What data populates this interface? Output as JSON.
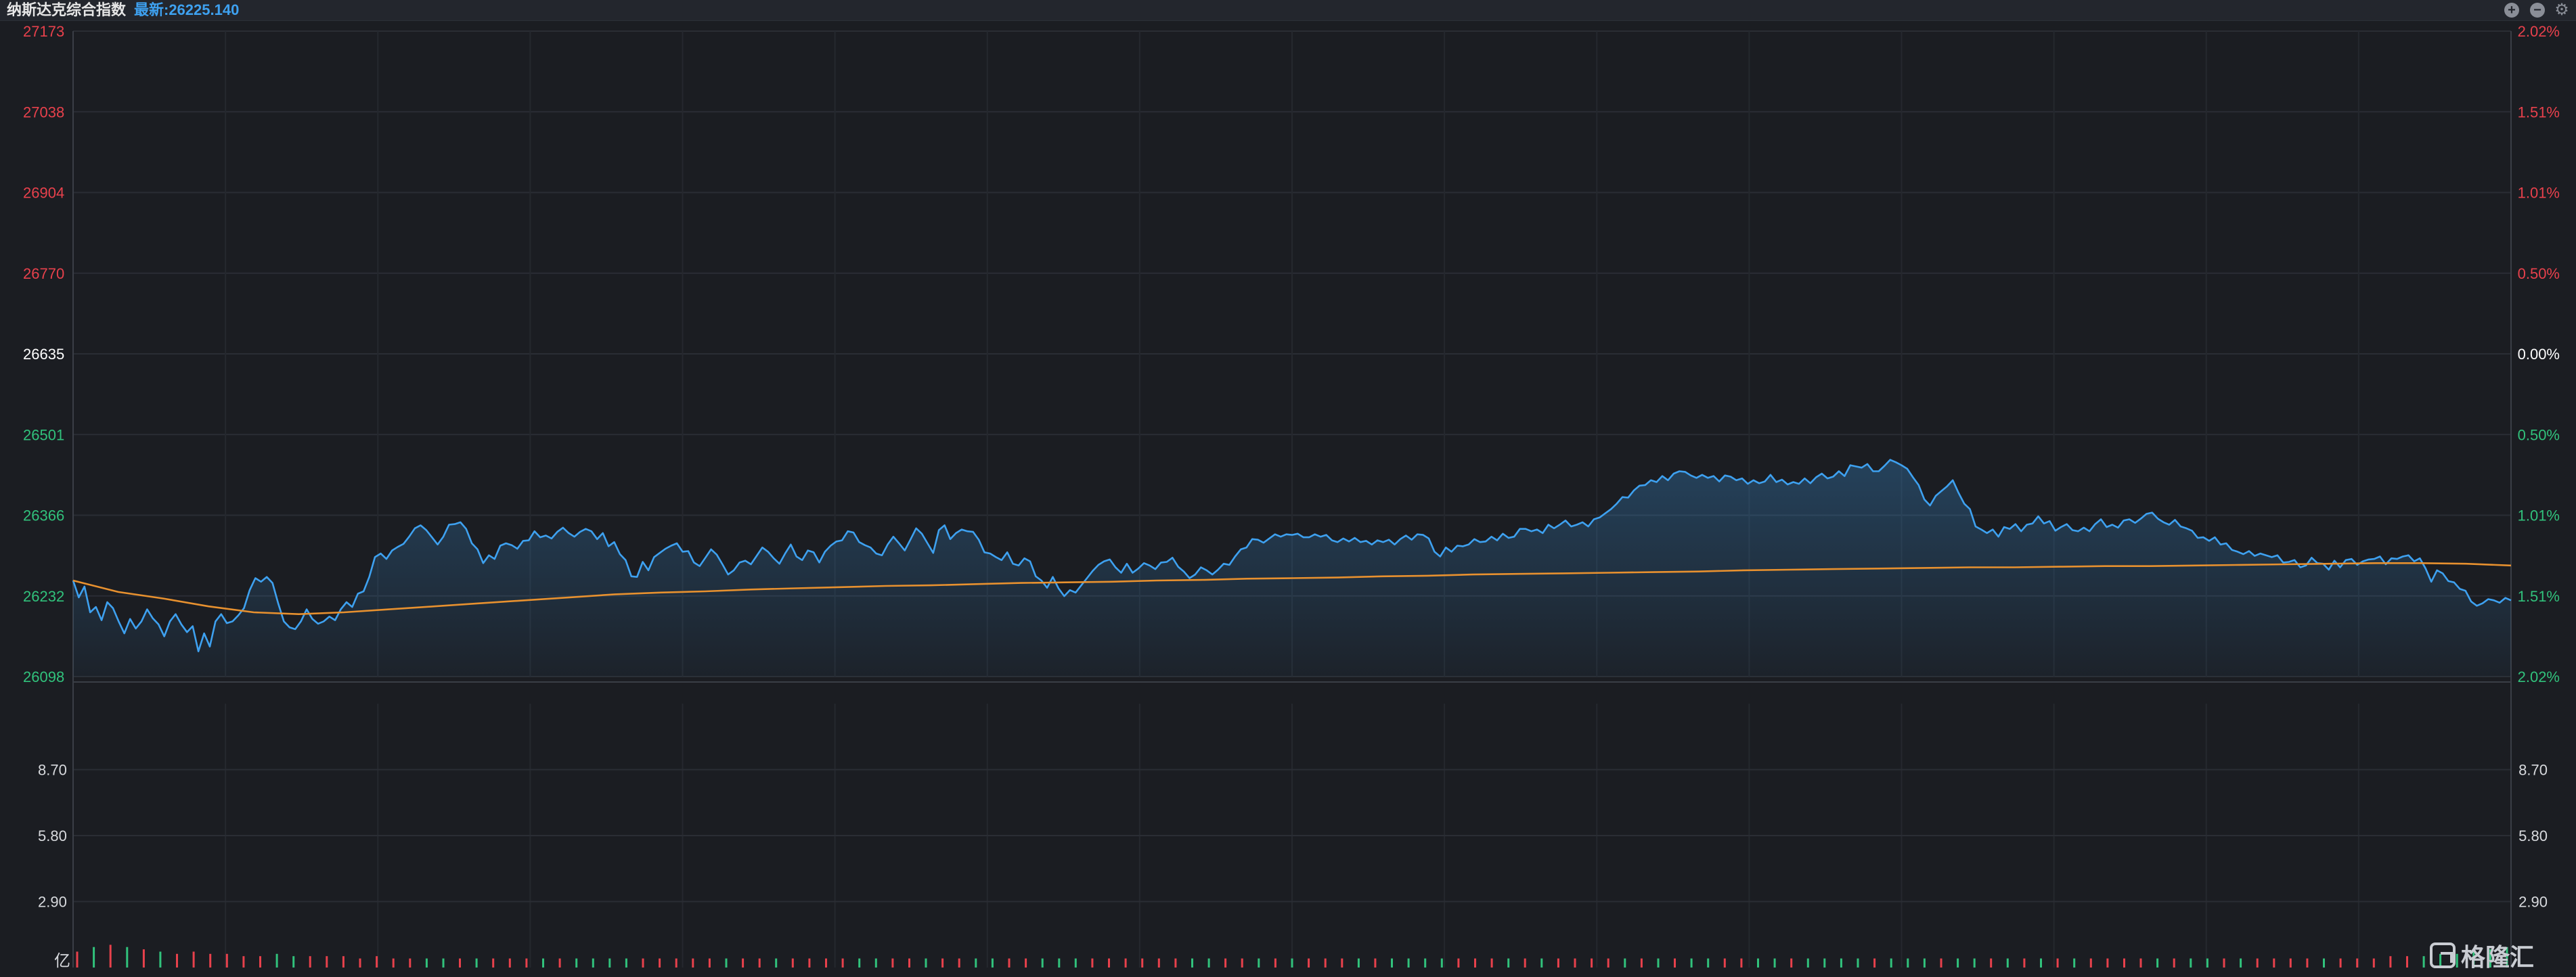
{
  "header": {
    "index_name": "纳斯达克综合指数",
    "latest_label": "最新:26225.140"
  },
  "window_controls": {
    "zoom_in_icon": "plus-circle-icon",
    "zoom_out_icon": "minus-circle-icon",
    "settings_icon": "gear-icon"
  },
  "watermark": {
    "text": "格隆汇"
  },
  "colors": {
    "up": "#e8414c",
    "down": "#31c27c",
    "neutral": "#ffffff",
    "price_line": "#3ea1f0",
    "avg_line": "#e8912f",
    "background": "#1b1d22"
  },
  "chart_data": [
    {
      "type": "line",
      "title": "",
      "prev_close": 26635,
      "ylim": [
        26098,
        27173
      ],
      "y_ticks_left": [
        "27173",
        "27038",
        "26904",
        "26770",
        "26635",
        "26501",
        "26366",
        "26232",
        "26098"
      ],
      "y_ticks_right": [
        "2.02%",
        "1.51%",
        "1.01%",
        "0.50%",
        "0.00%",
        "0.50%",
        "1.01%",
        "1.51%",
        "2.02%"
      ],
      "grid": true,
      "series": [
        {
          "values": [
            26258,
            26230,
            26248,
            26205,
            26214,
            26192,
            26222,
            26212,
            26190,
            26170,
            26194,
            26178,
            26190,
            26210,
            26195,
            26185,
            26165,
            26190,
            26202,
            26185,
            26172,
            26182,
            26140,
            26170,
            26148,
            26190,
            26202,
            26187,
            26190,
            26200,
            26212,
            26242,
            26262,
            26256,
            26264,
            26254,
            26220,
            26190,
            26180,
            26177,
            26190,
            26210,
            26194,
            26186,
            26190,
            26198,
            26192,
            26210,
            26222,
            26214,
            26236,
            26240,
            26264,
            26297,
            26303,
            26294,
            26308,
            26314,
            26319,
            26331,
            26345,
            26350,
            26342,
            26330,
            26318,
            26331,
            26351,
            26352,
            26355,
            26344,
            26320,
            26310,
            26287,
            26300,
            26294,
            26316,
            26320,
            26317,
            26311,
            26324,
            26325,
            26340,
            26330,
            26333,
            26328,
            26339,
            26346,
            26337,
            26331,
            26339,
            26344,
            26340,
            26327,
            26337,
            26315,
            26322,
            26302,
            26292,
            26265,
            26264,
            26289,
            26275,
            26297,
            26304,
            26311,
            26316,
            26320,
            26306,
            26307,
            26288,
            26282,
            26296,
            26310,
            26301,
            26285,
            26268,
            26275,
            26288,
            26291,
            26285,
            26299,
            26313,
            26306,
            26295,
            26286,
            26303,
            26318,
            26298,
            26292,
            26308,
            26305,
            26288,
            26306,
            26316,
            26323,
            26325,
            26340,
            26338,
            26322,
            26317,
            26313,
            26303,
            26300,
            26318,
            26331,
            26320,
            26308,
            26326,
            26345,
            26336,
            26320,
            26304,
            26342,
            26350,
            26327,
            26337,
            26343,
            26340,
            26339,
            26326,
            26305,
            26303,
            26297,
            26292,
            26305,
            26286,
            26283,
            26295,
            26290,
            26265,
            26258,
            26246,
            26264,
            26245,
            26232,
            26242,
            26238,
            26250,
            26262,
            26274,
            26284,
            26290,
            26293,
            26280,
            26271,
            26286,
            26271,
            26278,
            26287,
            26283,
            26277,
            26288,
            26289,
            26296,
            26281,
            26273,
            26262,
            26268,
            26280,
            26275,
            26268,
            26276,
            26286,
            26284,
            26298,
            26310,
            26313,
            26327,
            26326,
            26321,
            26328,
            26335,
            26331,
            26335,
            26334,
            26336,
            26330,
            26330,
            26335,
            26331,
            26334,
            26325,
            26322,
            26328,
            26323,
            26329,
            26322,
            26324,
            26318,
            26325,
            26322,
            26326,
            26318,
            26327,
            26333,
            26326,
            26335,
            26334,
            26328,
            26306,
            26298,
            26313,
            26306,
            26316,
            26315,
            26318,
            26327,
            26322,
            26323,
            26331,
            26325,
            26336,
            26329,
            26331,
            26344,
            26344,
            26340,
            26343,
            26337,
            26351,
            26345,
            26351,
            26358,
            26348,
            26351,
            26355,
            26348,
            26360,
            26363,
            26370,
            26377,
            26386,
            26397,
            26396,
            26408,
            26416,
            26417,
            26425,
            26422,
            26432,
            26425,
            26436,
            26440,
            26439,
            26433,
            26429,
            26434,
            26429,
            26432,
            26423,
            26433,
            26431,
            26425,
            26428,
            26419,
            26425,
            26420,
            26423,
            26434,
            26422,
            26426,
            26418,
            26422,
            26419,
            26428,
            26420,
            26430,
            26436,
            26428,
            26431,
            26440,
            26432,
            26450,
            26448,
            26446,
            26452,
            26440,
            26440,
            26449,
            26459,
            26455,
            26450,
            26444,
            26430,
            26417,
            26393,
            26383,
            26399,
            26407,
            26415,
            26425,
            26404,
            26386,
            26377,
            26348,
            26343,
            26337,
            26343,
            26331,
            26347,
            26344,
            26352,
            26340,
            26351,
            26353,
            26365,
            26353,
            26357,
            26341,
            26347,
            26352,
            26342,
            26340,
            26346,
            26340,
            26352,
            26360,
            26347,
            26351,
            26346,
            26358,
            26360,
            26354,
            26361,
            26369,
            26371,
            26361,
            26355,
            26351,
            26359,
            26348,
            26345,
            26341,
            26329,
            26330,
            26324,
            26330,
            26318,
            26320,
            26309,
            26306,
            26302,
            26307,
            26299,
            26303,
            26300,
            26297,
            26300,
            26288,
            26289,
            26292,
            26280,
            26283,
            26296,
            26287,
            26286,
            26276,
            26291,
            26280,
            26292,
            26294,
            26284,
            26290,
            26293,
            26294,
            26298,
            26285,
            26295,
            26294,
            26298,
            26300,
            26290,
            26295,
            26278,
            26256,
            26275,
            26270,
            26257,
            26255,
            26244,
            26241,
            26223,
            26216,
            26220,
            26227,
            26225,
            26221,
            26229,
            26225
          ]
        },
        {
          "values": [
            26258,
            26239,
            26228,
            26215,
            26205,
            26202,
            26205,
            26210,
            26215,
            26220,
            26225,
            26230,
            26235,
            26238,
            26240,
            26243,
            26245,
            26247,
            26249,
            26250,
            26252,
            26254,
            26255,
            26256,
            26258,
            26259,
            26261,
            26262,
            26263,
            26265,
            26266,
            26268,
            26269,
            26270,
            26271,
            26272,
            26273,
            26275,
            26276,
            26277,
            26278,
            26279,
            26280,
            26280,
            26281,
            26282,
            26282,
            26283,
            26284,
            26285,
            26286,
            26287,
            26287,
            26286,
            26283
          ]
        }
      ]
    },
    {
      "type": "bar",
      "title": "",
      "ylabel": "亿",
      "y_ticks": [
        "8.70",
        "5.80",
        "2.90"
      ],
      "ylim": [
        0,
        11.6
      ],
      "grid": true,
      "values": [
        0.7,
        0.9,
        1.0,
        0.9,
        0.8,
        0.7,
        0.6,
        0.7,
        0.6,
        0.6,
        0.5,
        0.5,
        0.6,
        0.5,
        0.5,
        0.5,
        0.5,
        0.4,
        0.5,
        0.4,
        0.4,
        0.4,
        0.4,
        0.4,
        0.4,
        0.4,
        0.4,
        0.4,
        0.4,
        0.4,
        0.4,
        0.4,
        0.4,
        0.4,
        0.4,
        0.4,
        0.4,
        0.4,
        0.4,
        0.4,
        0.4,
        0.4,
        0.4,
        0.4,
        0.4,
        0.4,
        0.4,
        0.4,
        0.4,
        0.4,
        0.4,
        0.4,
        0.4,
        0.4,
        0.4,
        0.4,
        0.4,
        0.4,
        0.4,
        0.4,
        0.4,
        0.4,
        0.4,
        0.4,
        0.4,
        0.4,
        0.4,
        0.4,
        0.4,
        0.4,
        0.4,
        0.4,
        0.4,
        0.4,
        0.4,
        0.4,
        0.4,
        0.4,
        0.4,
        0.4,
        0.4,
        0.4,
        0.4,
        0.4,
        0.4,
        0.4,
        0.4,
        0.4,
        0.4,
        0.4,
        0.4,
        0.4,
        0.4,
        0.4,
        0.4,
        0.4,
        0.4,
        0.4,
        0.4,
        0.4,
        0.4,
        0.4,
        0.4,
        0.4,
        0.4,
        0.4,
        0.4,
        0.4,
        0.4,
        0.4,
        0.4,
        0.4,
        0.4,
        0.4,
        0.4,
        0.4,
        0.4,
        0.4,
        0.4,
        0.4,
        0.4,
        0.4,
        0.4,
        0.4,
        0.4,
        0.4,
        0.4,
        0.4,
        0.4,
        0.4,
        0.4,
        0.4,
        0.4,
        0.4,
        0.4,
        0.4,
        0.4,
        0.4,
        0.4,
        0.5,
        0.5,
        0.5,
        0.6,
        0.6,
        0.7,
        0.8,
        0.9
      ]
    }
  ]
}
